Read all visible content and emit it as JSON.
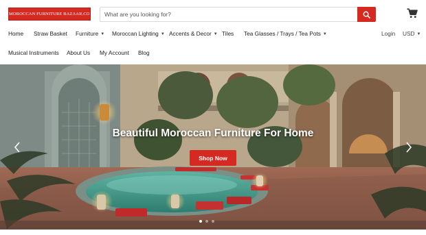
{
  "header": {
    "logo_text": "MOROCCAN FURNITURE BAZAAR.COM",
    "search_placeholder": "What are you looking for?"
  },
  "nav": {
    "row1": [
      {
        "label": "Home",
        "dropdown": false
      },
      {
        "label": "Straw Basket",
        "dropdown": false
      },
      {
        "label": "Furniture",
        "dropdown": true
      },
      {
        "label": "Moroccan Lighting",
        "dropdown": true
      },
      {
        "label": "Accents & Decor",
        "dropdown": true
      },
      {
        "label": "Tiles",
        "dropdown": false
      },
      {
        "label": "Tea Glasses / Trays / Tea Pots",
        "dropdown": true
      }
    ],
    "row2": [
      {
        "label": "Musical Instruments"
      },
      {
        "label": "About Us"
      },
      {
        "label": "My Account"
      },
      {
        "label": "Blog"
      }
    ],
    "login": "Login",
    "currency": "USD",
    "caret": "▼"
  },
  "hero": {
    "title": "Beautiful Moroccan Furniture For Home",
    "button_label": "Shop Now",
    "slide_count": 3,
    "active_slide": 1
  },
  "colors": {
    "accent": "#d42a22"
  },
  "icons": {
    "search": "search-icon",
    "cart": "cart-icon",
    "prev": "chevron-left-icon",
    "next": "chevron-right-icon"
  }
}
